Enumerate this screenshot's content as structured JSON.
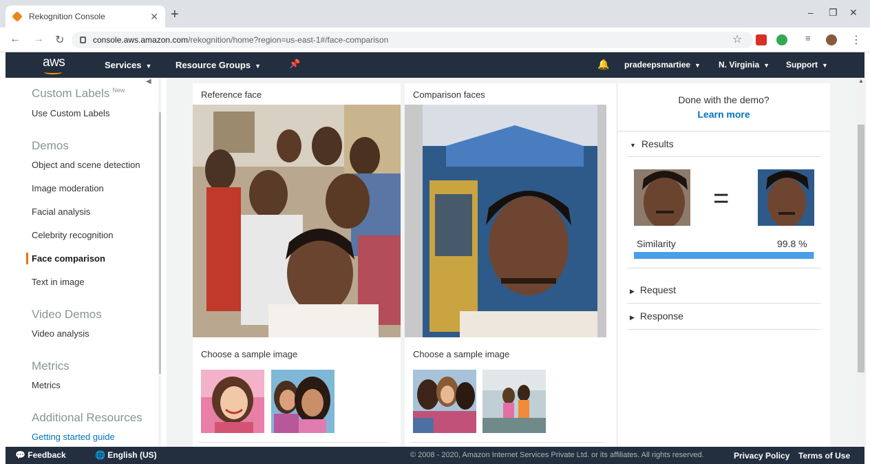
{
  "browser": {
    "tab_title": "Rekognition Console",
    "url_host": "console.aws.amazon.com",
    "url_path": "/rekognition/home?region=us-east-1#/face-comparison"
  },
  "aws_nav": {
    "logo": "aws",
    "services": "Services",
    "resource_groups": "Resource Groups",
    "user": "pradeepsmartiee",
    "region": "N. Virginia",
    "support": "Support"
  },
  "sidebar": {
    "custom_labels_head": "Custom Labels",
    "new_badge": "New",
    "use_custom_labels": "Use Custom Labels",
    "demos_head": "Demos",
    "demos": [
      "Object and scene detection",
      "Image moderation",
      "Facial analysis",
      "Celebrity recognition",
      "Face comparison",
      "Text in image"
    ],
    "video_head": "Video Demos",
    "video_analysis": "Video analysis",
    "metrics_head": "Metrics",
    "metrics": "Metrics",
    "resources_head": "Additional Resources",
    "getting_started": "Getting started guide"
  },
  "reference": {
    "label": "Reference face",
    "sample_label": "Choose a sample image"
  },
  "comparison": {
    "label": "Comparison faces",
    "sample_label": "Choose a sample image"
  },
  "results_panel": {
    "done_text": "Done with the demo?",
    "learn_more": "Learn more",
    "results": "Results",
    "equals": "=",
    "similarity_label": "Similarity",
    "similarity_value": "99.8 %",
    "similarity_fraction": 0.998,
    "request": "Request",
    "response": "Response"
  },
  "footer": {
    "feedback": "Feedback",
    "language": "English (US)",
    "copyright": "© 2008 - 2020, Amazon Internet Services Private Ltd. or its affiliates. All rights reserved.",
    "privacy": "Privacy Policy",
    "terms": "Terms of Use"
  }
}
